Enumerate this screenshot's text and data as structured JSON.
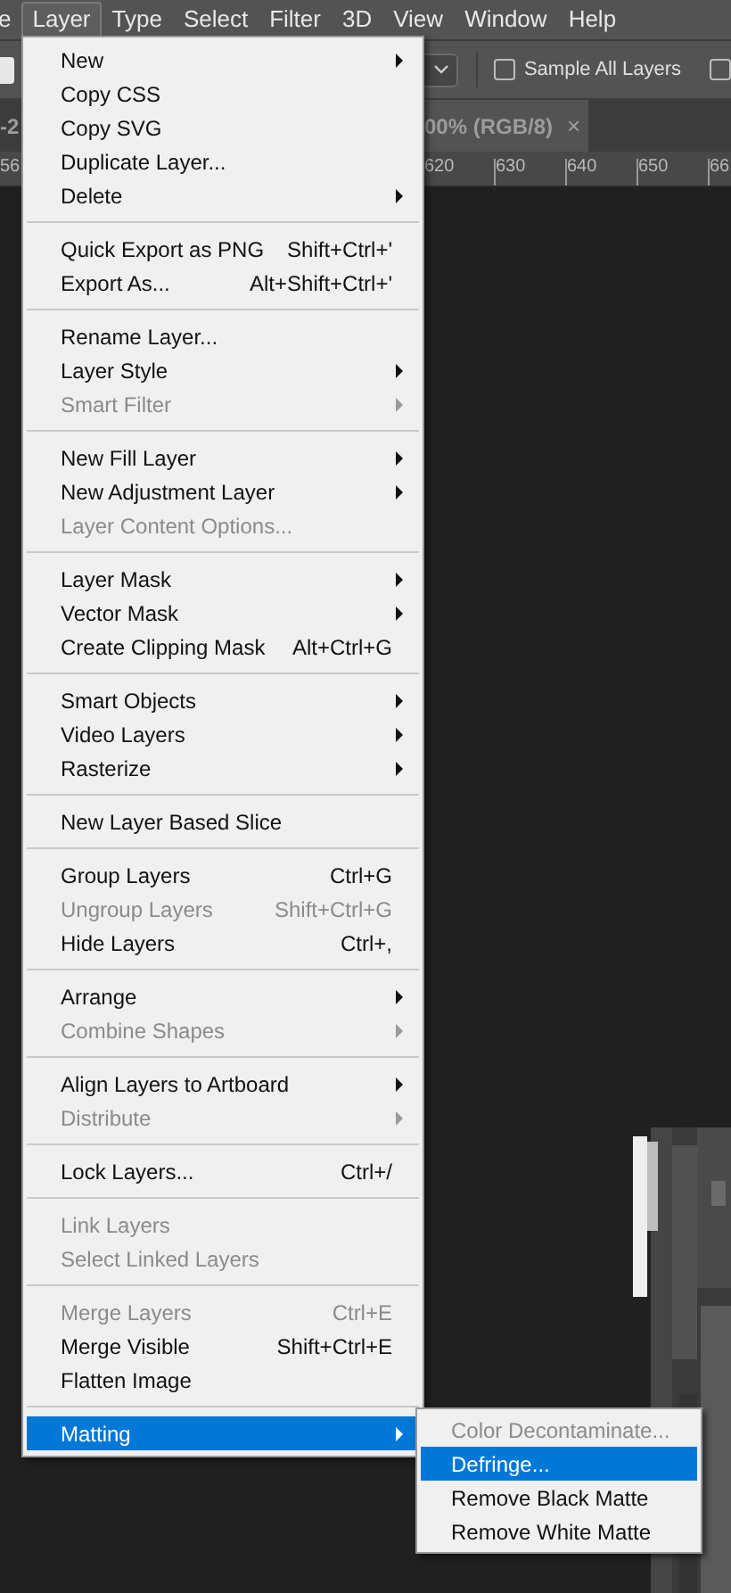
{
  "menu_bar": [
    {
      "label": "e",
      "selected": false
    },
    {
      "label": "Layer",
      "selected": true
    },
    {
      "label": "Type",
      "selected": false
    },
    {
      "label": "Select",
      "selected": false
    },
    {
      "label": "Filter",
      "selected": false
    },
    {
      "label": "3D",
      "selected": false
    },
    {
      "label": "View",
      "selected": false
    },
    {
      "label": "Window",
      "selected": false
    },
    {
      "label": "Help",
      "selected": false
    }
  ],
  "options_bar": {
    "checkboxes": [
      {
        "label": "Sample All Layers",
        "checked": false
      },
      {
        "checked": false
      }
    ]
  },
  "document_tabs": [
    {
      "label": "-2",
      "selected": false
    },
    {
      "label": "00% (RGB/8)",
      "close": "×",
      "selected": true
    }
  ],
  "ruler": {
    "labels": [
      "56",
      "620",
      "630",
      "640",
      "650",
      "66"
    ]
  },
  "layer_menu": {
    "groups": [
      [
        {
          "label": "New",
          "submenu": true,
          "disabled": false,
          "selected": false
        },
        {
          "label": "Copy CSS",
          "disabled": false,
          "selected": false
        },
        {
          "label": "Copy SVG",
          "disabled": false,
          "selected": false
        },
        {
          "label": "Duplicate Layer...",
          "disabled": false,
          "selected": false
        },
        {
          "label": "Delete",
          "submenu": true,
          "disabled": false,
          "selected": false
        }
      ],
      [
        {
          "label": "Quick Export as PNG",
          "shortcut": "Shift+Ctrl+'",
          "disabled": false,
          "selected": false
        },
        {
          "label": "Export As...",
          "shortcut": "Alt+Shift+Ctrl+'",
          "disabled": false,
          "selected": false
        }
      ],
      [
        {
          "label": "Rename Layer...",
          "disabled": false,
          "selected": false
        },
        {
          "label": "Layer Style",
          "submenu": true,
          "disabled": false,
          "selected": false
        },
        {
          "label": "Smart Filter",
          "submenu": true,
          "disabled": true,
          "selected": false
        }
      ],
      [
        {
          "label": "New Fill Layer",
          "submenu": true,
          "disabled": false,
          "selected": false
        },
        {
          "label": "New Adjustment Layer",
          "submenu": true,
          "disabled": false,
          "selected": false
        },
        {
          "label": "Layer Content Options...",
          "disabled": true,
          "selected": false
        }
      ],
      [
        {
          "label": "Layer Mask",
          "submenu": true,
          "disabled": false,
          "selected": false
        },
        {
          "label": "Vector Mask",
          "submenu": true,
          "disabled": false,
          "selected": false
        },
        {
          "label": "Create Clipping Mask",
          "shortcut": "Alt+Ctrl+G",
          "disabled": false,
          "selected": false
        }
      ],
      [
        {
          "label": "Smart Objects",
          "submenu": true,
          "disabled": false,
          "selected": false
        },
        {
          "label": "Video Layers",
          "submenu": true,
          "disabled": false,
          "selected": false
        },
        {
          "label": "Rasterize",
          "submenu": true,
          "disabled": false,
          "selected": false
        }
      ],
      [
        {
          "label": "New Layer Based Slice",
          "disabled": false,
          "selected": false
        }
      ],
      [
        {
          "label": "Group Layers",
          "shortcut": "Ctrl+G",
          "disabled": false,
          "selected": false
        },
        {
          "label": "Ungroup Layers",
          "shortcut": "Shift+Ctrl+G",
          "disabled": true,
          "selected": false
        },
        {
          "label": "Hide Layers",
          "shortcut": "Ctrl+,",
          "disabled": false,
          "selected": false
        }
      ],
      [
        {
          "label": "Arrange",
          "submenu": true,
          "disabled": false,
          "selected": false
        },
        {
          "label": "Combine Shapes",
          "submenu": true,
          "disabled": true,
          "selected": false
        }
      ],
      [
        {
          "label": "Align Layers to Artboard",
          "submenu": true,
          "disabled": false,
          "selected": false
        },
        {
          "label": "Distribute",
          "submenu": true,
          "disabled": true,
          "selected": false
        }
      ],
      [
        {
          "label": "Lock Layers...",
          "shortcut": "Ctrl+/",
          "disabled": false,
          "selected": false
        }
      ],
      [
        {
          "label": "Link Layers",
          "disabled": true,
          "selected": false
        },
        {
          "label": "Select Linked Layers",
          "disabled": true,
          "selected": false
        }
      ],
      [
        {
          "label": "Merge Layers",
          "shortcut": "Ctrl+E",
          "disabled": true,
          "selected": false
        },
        {
          "label": "Merge Visible",
          "shortcut": "Shift+Ctrl+E",
          "disabled": false,
          "selected": false
        },
        {
          "label": "Flatten Image",
          "disabled": false,
          "selected": false
        }
      ],
      [
        {
          "label": "Matting",
          "submenu": true,
          "disabled": false,
          "selected": true
        }
      ]
    ]
  },
  "matting_submenu": [
    {
      "label": "Color Decontaminate...",
      "disabled": true,
      "selected": false
    },
    {
      "label": "Defringe...",
      "disabled": false,
      "selected": true
    },
    {
      "label": "Remove Black Matte",
      "disabled": false,
      "selected": false
    },
    {
      "label": "Remove White Matte",
      "disabled": false,
      "selected": false
    }
  ]
}
